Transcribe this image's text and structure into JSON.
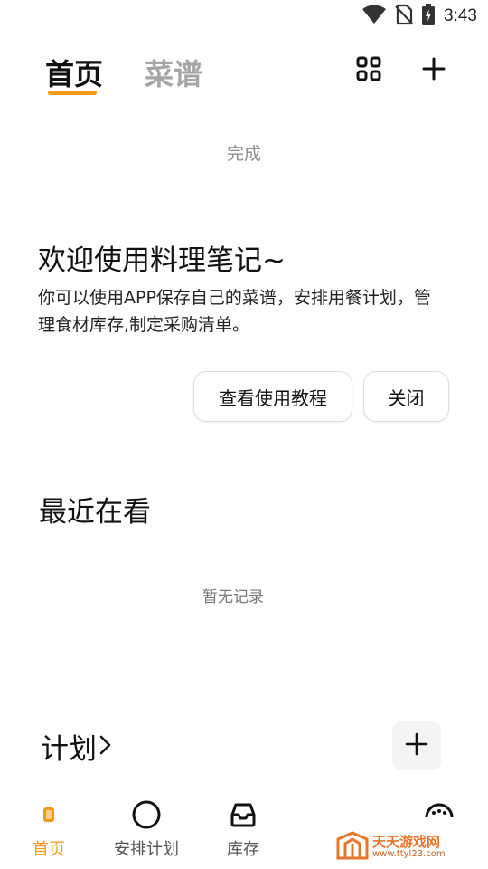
{
  "status_bar": {
    "time": "3:43",
    "icons": [
      "wifi-icon",
      "no-sim-icon",
      "battery-charging-icon"
    ]
  },
  "header": {
    "tabs": [
      {
        "label": "首页",
        "active": true
      },
      {
        "label": "菜谱",
        "active": false
      }
    ],
    "grid_icon": "grid-icon",
    "add_icon": "plus-icon"
  },
  "done_label": "完成",
  "welcome": {
    "title": "欢迎使用料理笔记~",
    "text": "你可以使用APP保存自己的菜谱，安排用餐计划，管理食材库存,制定采购清单。",
    "tutorial_button": "查看使用教程",
    "close_button": "关闭"
  },
  "recent": {
    "title": "最近在看",
    "empty_text": "暂无记录"
  },
  "plan": {
    "title": "计划",
    "chevron": "›"
  },
  "bottom_nav": [
    {
      "label": "首页",
      "icon": "home-icon",
      "active": true
    },
    {
      "label": "安排计划",
      "icon": "circle-icon",
      "active": false
    },
    {
      "label": "库存",
      "icon": "inbox-icon",
      "active": false
    },
    {
      "label": "",
      "icon": "more-icon",
      "active": false
    }
  ],
  "watermark": {
    "line1": "天天游戏网",
    "line2": "www.ttyl23.com"
  },
  "colors": {
    "accent": "#f39a1c",
    "inactive_tab": "#a5a5a5",
    "watermark": "#e8742a"
  }
}
